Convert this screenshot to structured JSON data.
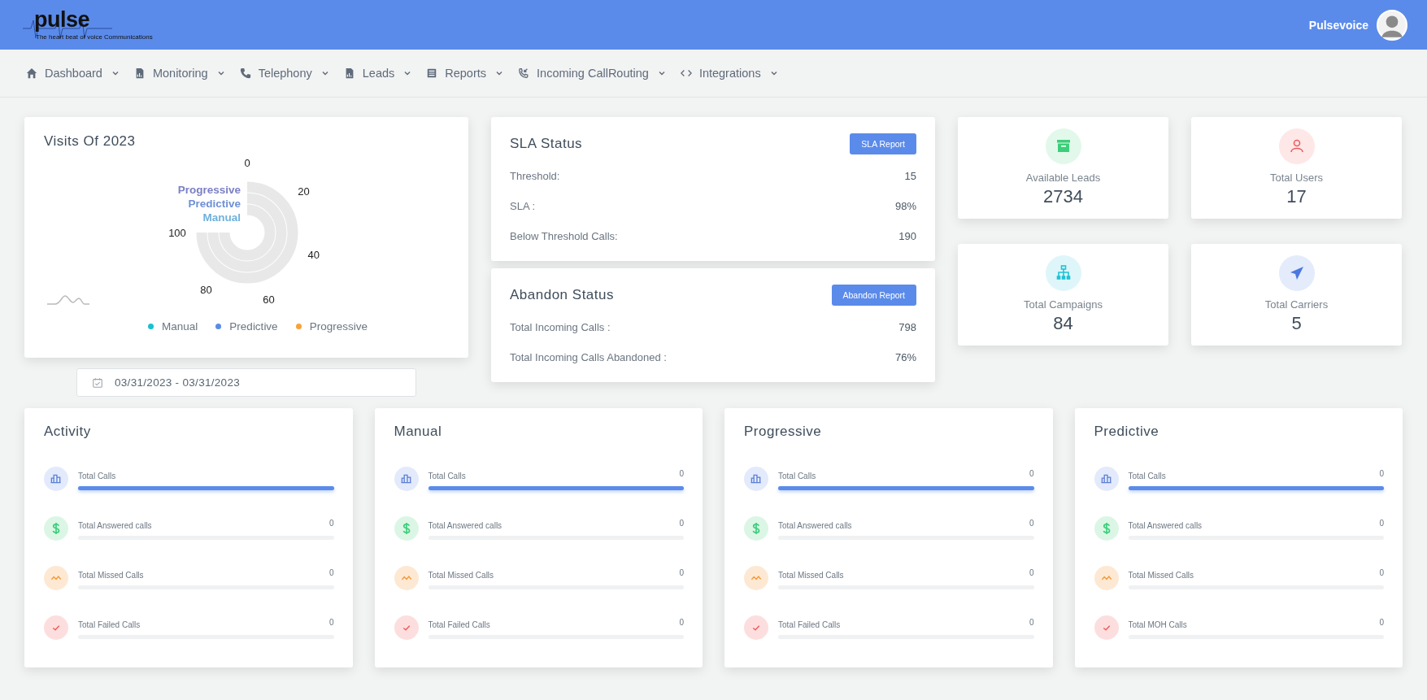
{
  "header": {
    "logo": {
      "name": "pulse",
      "tagline": "The heart beat of voice Communications"
    },
    "user": "Pulsevoice"
  },
  "nav": [
    {
      "label": "Dashboard"
    },
    {
      "label": "Monitoring"
    },
    {
      "label": "Telephony"
    },
    {
      "label": "Leads"
    },
    {
      "label": "Reports"
    },
    {
      "label": "Incoming CallRouting"
    },
    {
      "label": "Integrations"
    }
  ],
  "visits": {
    "title": "Visits Of 2023",
    "ticks": [
      "0",
      "20",
      "40",
      "60",
      "80",
      "100"
    ],
    "series_labels": [
      {
        "label": "Progressive",
        "color": "#7b7fc4"
      },
      {
        "label": "Predictive",
        "color": "#6f90d6"
      },
      {
        "label": "Manual",
        "color": "#6fb1dc"
      }
    ],
    "legend": [
      {
        "label": "Manual",
        "color": "#17c1d1"
      },
      {
        "label": "Predictive",
        "color": "#5b8be8"
      },
      {
        "label": "Progressive",
        "color": "#f7a23b"
      }
    ]
  },
  "date_range": {
    "value": "03/31/2023 - 03/31/2023"
  },
  "status_cards": [
    {
      "title": "SLA Status",
      "button": "SLA Report",
      "rows": [
        {
          "label": "Threshold:",
          "value": "15"
        },
        {
          "label": "SLA :",
          "value": "98%"
        },
        {
          "label": "Below Threshold Calls:",
          "value": "190"
        }
      ]
    },
    {
      "title": "Abandon Status",
      "button": "Abandon Report",
      "rows": [
        {
          "label": "Total Incoming Calls :",
          "value": "798"
        },
        {
          "label": "Total Incoming Calls Abandoned :",
          "value": "76%"
        }
      ]
    }
  ],
  "stats": [
    {
      "label": "Available Leads",
      "value": "2734",
      "color": "#3ccf7a"
    },
    {
      "label": "Total Users",
      "value": "17",
      "color": "#ef5b5b"
    },
    {
      "label": "Total Campaigns",
      "value": "84",
      "color": "#1fc3d6"
    },
    {
      "label": "Total Carriers",
      "value": "5",
      "color": "#4a78e0"
    }
  ],
  "activity_cards": [
    {
      "title": "Activity",
      "rows": [
        {
          "kind": "calls",
          "label": "Total Calls",
          "level": 1
        },
        {
          "kind": "answered",
          "label": "Total Answered calls",
          "value": "0",
          "level": 0
        },
        {
          "kind": "missed",
          "label": "Total Missed Calls",
          "value": "0",
          "level": 0
        },
        {
          "kind": "failed",
          "label": "Total Failed Calls",
          "value": "0",
          "level": 0
        }
      ]
    },
    {
      "title": "Manual",
      "rows": [
        {
          "kind": "calls",
          "label": "Total Calls",
          "value": "0",
          "level": 1
        },
        {
          "kind": "answered",
          "label": "Total Answered calls",
          "value": "0",
          "level": 0
        },
        {
          "kind": "missed",
          "label": "Total Missed Calls",
          "value": "0",
          "level": 0
        },
        {
          "kind": "failed",
          "label": "Total Failed Calls",
          "value": "0",
          "level": 0
        }
      ]
    },
    {
      "title": "Progressive",
      "rows": [
        {
          "kind": "calls",
          "label": "Total Calls",
          "value": "0",
          "level": 1
        },
        {
          "kind": "answered",
          "label": "Total Answered calls",
          "value": "0",
          "level": 0
        },
        {
          "kind": "missed",
          "label": "Total Missed Calls",
          "value": "0",
          "level": 0
        },
        {
          "kind": "failed",
          "label": "Total Failed Calls",
          "value": "0",
          "level": 0
        }
      ]
    },
    {
      "title": "Predictive",
      "rows": [
        {
          "kind": "calls",
          "label": "Total Calls",
          "value": "0",
          "level": 1
        },
        {
          "kind": "answered",
          "label": "Total Answered calls",
          "value": "0",
          "level": 0
        },
        {
          "kind": "missed",
          "label": "Total Missed Calls",
          "value": "0",
          "level": 0
        },
        {
          "kind": "failed",
          "label": "Total MOH Calls",
          "value": "0",
          "level": 0
        }
      ]
    }
  ]
}
